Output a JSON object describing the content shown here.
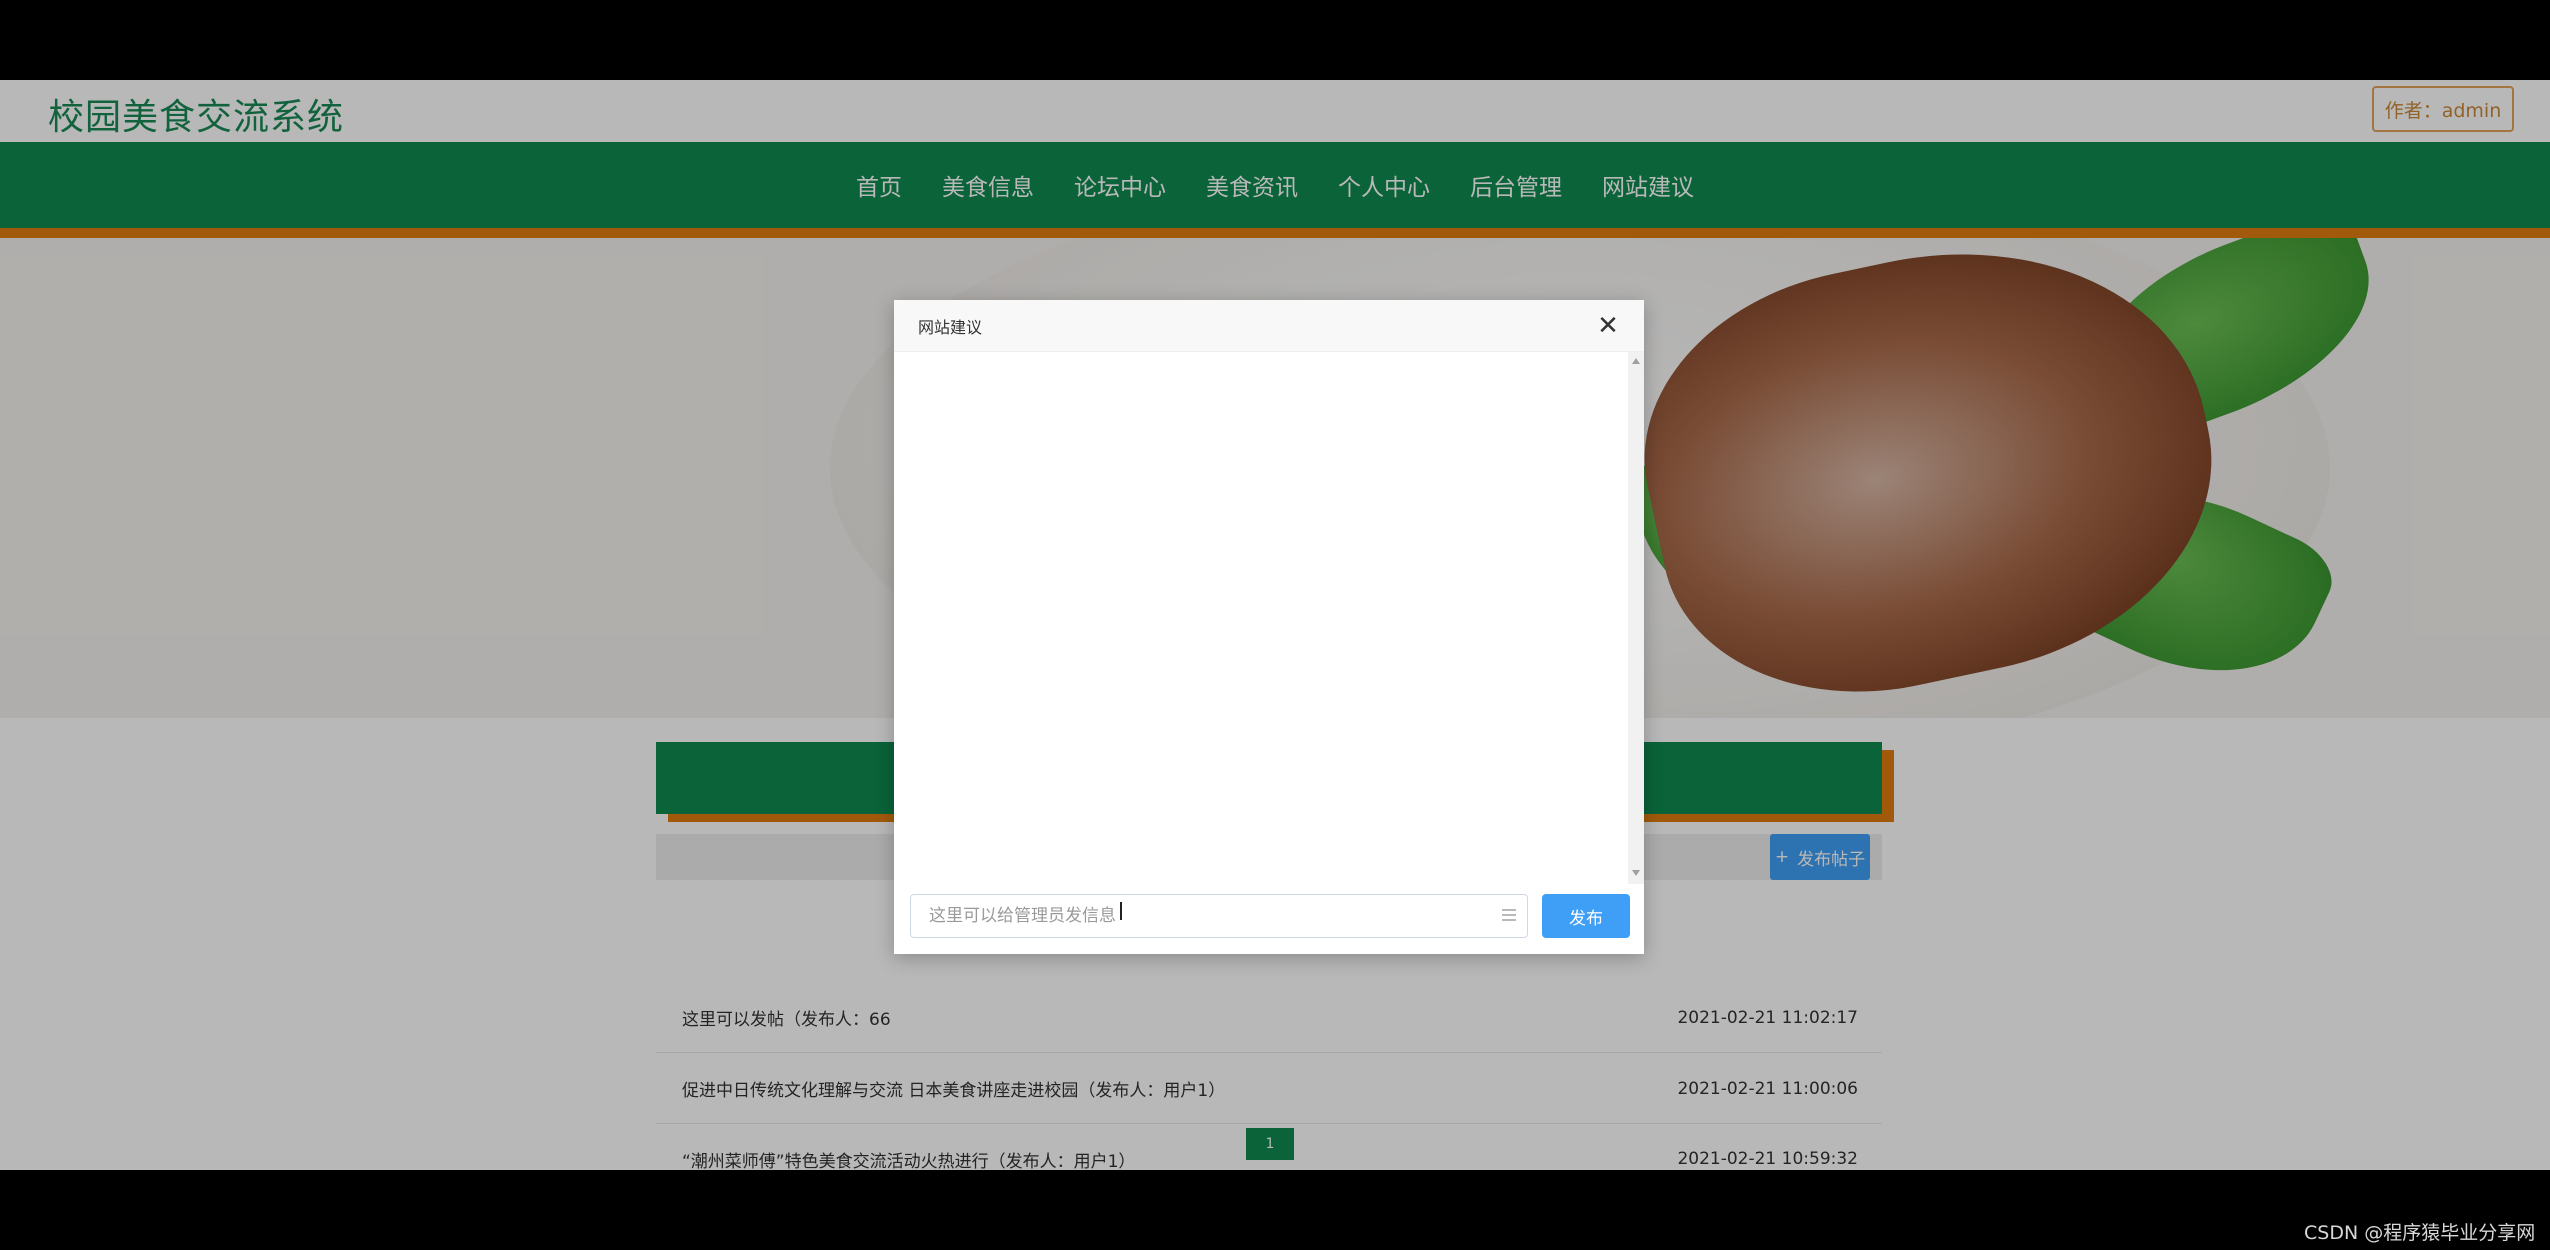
{
  "header": {
    "site_title": "校园美食交流系统",
    "user_badge": "作者：admin"
  },
  "nav": {
    "items": [
      {
        "label": "首页"
      },
      {
        "label": "美食信息"
      },
      {
        "label": "论坛中心"
      },
      {
        "label": "美食资讯"
      },
      {
        "label": "个人中心"
      },
      {
        "label": "后台管理"
      },
      {
        "label": "网站建议"
      }
    ]
  },
  "forum": {
    "post_button": "发布帖子",
    "posts": [
      {
        "title": "这里可以发帖（发布人：66",
        "time": "2021-02-21 11:02:17"
      },
      {
        "title": "促进中日传统文化理解与交流 日本美食讲座走进校园（发布人：用户1）",
        "time": "2021-02-21 11:00:06"
      },
      {
        "title": "“潮州菜师傅”特色美食交流活动火热进行（发布人：用户1）",
        "time": "2021-02-21 10:59:32"
      }
    ],
    "page_current": "1"
  },
  "dialog": {
    "title": "网站建议",
    "close_symbol": "✕",
    "input_placeholder": "这里可以给管理员发信息",
    "input_value": "",
    "send_button": "发布"
  },
  "watermark": "CSDN @程序猿毕业分享网",
  "colors": {
    "primary_green": "#0e8a4f",
    "accent_orange": "#e07d10",
    "button_blue": "#3f9ef5"
  }
}
